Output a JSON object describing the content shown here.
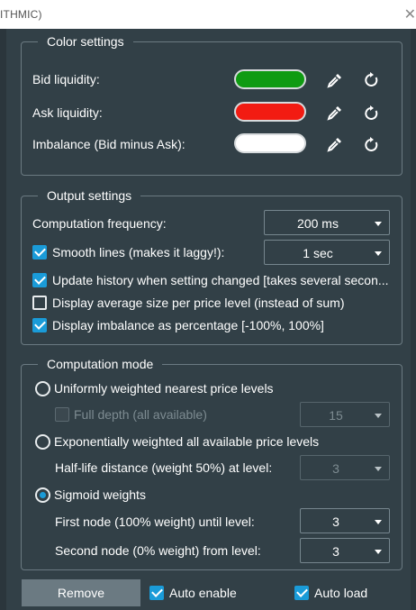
{
  "window": {
    "title": "ITHMIC)",
    "close_glyph": "✕"
  },
  "color_settings": {
    "legend": "Color settings",
    "rows": [
      {
        "label": "Bid liquidity:",
        "color": "#0f9b12"
      },
      {
        "label": "Ask liquidity:",
        "color": "#f21b12"
      },
      {
        "label": "Imbalance (Bid minus Ask):",
        "color": "#ffffff"
      }
    ],
    "icons": [
      "eyedropper-icon",
      "reset-icon"
    ]
  },
  "output_settings": {
    "legend": "Output settings",
    "computation_frequency": {
      "label": "Computation frequency:",
      "value": "200 ms"
    },
    "smooth_lines": {
      "label": "Smooth lines (makes it laggy!):",
      "checked": true,
      "value": "1 sec"
    },
    "update_history": {
      "label": "Update history when setting changed [takes several secon...",
      "checked": true
    },
    "display_avg": {
      "label": "Display average size per price level (instead of sum)",
      "checked": false
    },
    "display_imbalance": {
      "label": "Display imbalance as percentage [-100%, 100%]",
      "checked": true
    }
  },
  "computation_mode": {
    "legend": "Computation mode",
    "uniform": {
      "label": "Uniformly weighted nearest price levels",
      "selected": false
    },
    "full_depth": {
      "label": "Full depth (all available)",
      "checked": false,
      "value": "15"
    },
    "exponential": {
      "label": "Exponentially weighted all available price levels",
      "selected": false
    },
    "half_life": {
      "label": "Half-life distance (weight 50%) at level:",
      "value": "3"
    },
    "sigmoid": {
      "label": "Sigmoid weights",
      "selected": true
    },
    "first_node": {
      "label": "First node (100% weight) until level:",
      "value": "3"
    },
    "second_node": {
      "label": "Second node (0% weight) from level:",
      "value": "3"
    }
  },
  "footer": {
    "remove_label": "Remove",
    "auto_enable": {
      "label": "Auto enable",
      "checked": true
    },
    "auto_load": {
      "label": "Auto load",
      "checked": true
    }
  }
}
